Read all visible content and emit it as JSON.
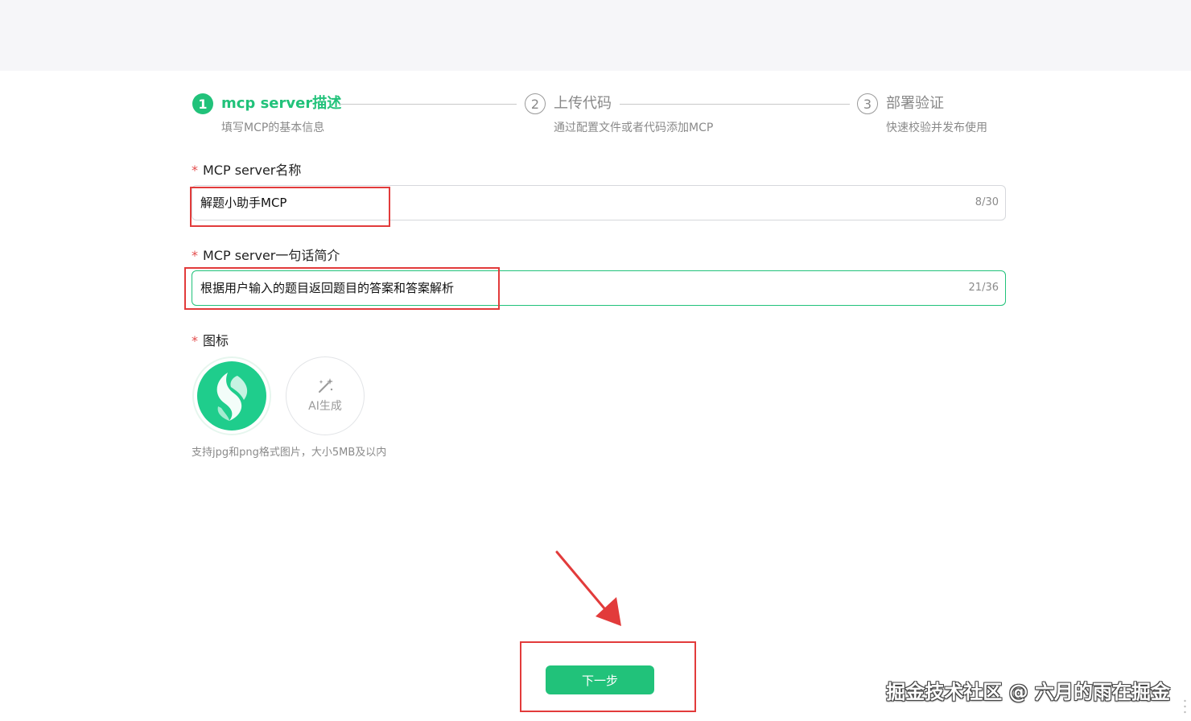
{
  "steps": [
    {
      "number": "1",
      "title": "mcp server描述",
      "description": "填写MCP的基本信息",
      "state": "active"
    },
    {
      "number": "2",
      "title": "上传代码",
      "description": "通过配置文件或者代码添加MCP",
      "state": "pending"
    },
    {
      "number": "3",
      "title": "部署验证",
      "description": "快速校验并发布使用",
      "state": "pending"
    }
  ],
  "form": {
    "name_field": {
      "required_mark": "*",
      "label": "MCP server名称",
      "value": "解题小助手MCP",
      "count": "8/30"
    },
    "intro_field": {
      "required_mark": "*",
      "label": "MCP server一句话简介",
      "value": "根据用户输入的题目返回题目的答案和答案解析",
      "count": "21/36"
    },
    "icon_field": {
      "required_mark": "*",
      "label": "图标",
      "ai_generate_label": "AI生成",
      "hint": "支持jpg和png格式图片，大小5MB及以内"
    }
  },
  "actions": {
    "next_label": "下一步"
  },
  "watermark": "掘金技术社区 @ 六月的雨在掘金",
  "colors": {
    "accent": "#21c27a",
    "annotation_red": "#e23b3b",
    "logo_green": "#1fcd8c"
  }
}
